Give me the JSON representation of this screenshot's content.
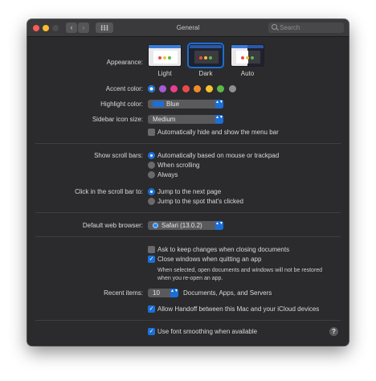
{
  "window": {
    "title": "General"
  },
  "toolbar": {
    "back_glyph": "‹",
    "forward_glyph": "›",
    "search_placeholder": "Search",
    "icons": [
      "close-dot",
      "minimize-dot",
      "zoom-dot",
      "chevron-left-icon",
      "chevron-right-icon",
      "grid-icon",
      "search-icon"
    ]
  },
  "appearance": {
    "label": "Appearance:",
    "options": [
      "Light",
      "Dark",
      "Auto"
    ],
    "selected": "Dark"
  },
  "accent": {
    "label": "Accent color:",
    "colors": [
      "#1b6fd8",
      "#a55bd6",
      "#e83f8c",
      "#ec4a4a",
      "#f18a2a",
      "#f5c231",
      "#5db847",
      "#8e8e93"
    ],
    "selected": "#1b6fd8"
  },
  "highlight": {
    "label": "Highlight color:",
    "value": "Blue"
  },
  "sidebar": {
    "label": "Sidebar icon size:",
    "value": "Medium"
  },
  "menubar": {
    "label": "Automatically hide and show the menu bar",
    "checked": false
  },
  "scrollbars": {
    "label": "Show scroll bars:",
    "options": [
      "Automatically based on mouse or trackpad",
      "When scrolling",
      "Always"
    ],
    "selected": "Automatically based on mouse or trackpad"
  },
  "click_scroll": {
    "label": "Click in the scroll bar to:",
    "options": [
      "Jump to the next page",
      "Jump to the spot that's clicked"
    ],
    "selected": "Jump to the next page"
  },
  "browser": {
    "label": "Default web browser:",
    "value": "Safari (13.0.2)"
  },
  "documents": {
    "ask_keep": {
      "label": "Ask to keep changes when closing documents",
      "checked": false
    },
    "close_windows": {
      "label": "Close windows when quitting an app",
      "checked": true
    },
    "note": "When selected, open documents and windows will not be restored when you re-open an app."
  },
  "recent": {
    "label": "Recent items:",
    "value": "10",
    "suffix": "Documents, Apps, and Servers"
  },
  "handoff": {
    "label": "Allow Handoff between this Mac and your iCloud devices",
    "checked": true
  },
  "font_smoothing": {
    "label": "Use font smoothing when available",
    "checked": true
  },
  "help": {
    "glyph": "?"
  },
  "glyphs": {
    "check": "✓",
    "stepper": "▲▼"
  }
}
